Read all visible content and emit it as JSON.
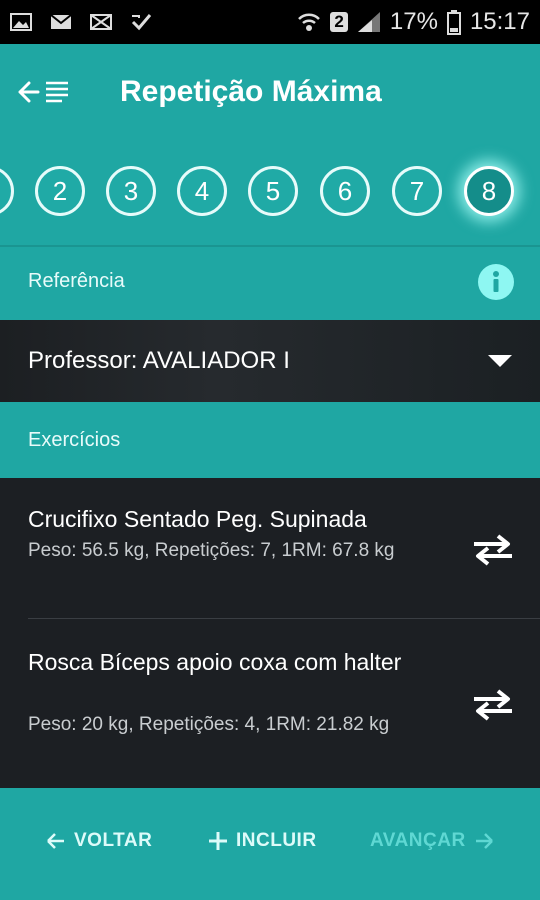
{
  "status_bar": {
    "battery_percent": "17%",
    "time": "15:17",
    "sim_badge": "2",
    "left_icons": [
      "gallery-icon",
      "gmail-icon",
      "mail-icon",
      "checkbox-icon"
    ]
  },
  "app_bar": {
    "title": "Repetição Máxima"
  },
  "steps": {
    "items": [
      "2",
      "3",
      "4",
      "5",
      "6",
      "7",
      "8"
    ],
    "active": "8"
  },
  "reference": {
    "label": "Referência"
  },
  "professor": {
    "text": "Professor: AVALIADOR I"
  },
  "exercises": {
    "label": "Exercícios",
    "items": [
      {
        "name": "Crucifixo Sentado Peg. Supinada",
        "detail": "Peso: 56.5 kg, Repetições: 7, 1RM: 67.8 kg"
      },
      {
        "name": "Rosca Bíceps apoio coxa com halter",
        "detail": "Peso: 20 kg, Repetições: 4, 1RM: 21.82 kg"
      }
    ]
  },
  "bottom_bar": {
    "back_label": "VOLTAR",
    "add_label": "INCLUIR",
    "next_label": "AVANÇAR"
  },
  "colors": {
    "primary": "#1fa7a3",
    "dark_panel": "#1c1f23",
    "info_icon": "#8ef7f2"
  }
}
